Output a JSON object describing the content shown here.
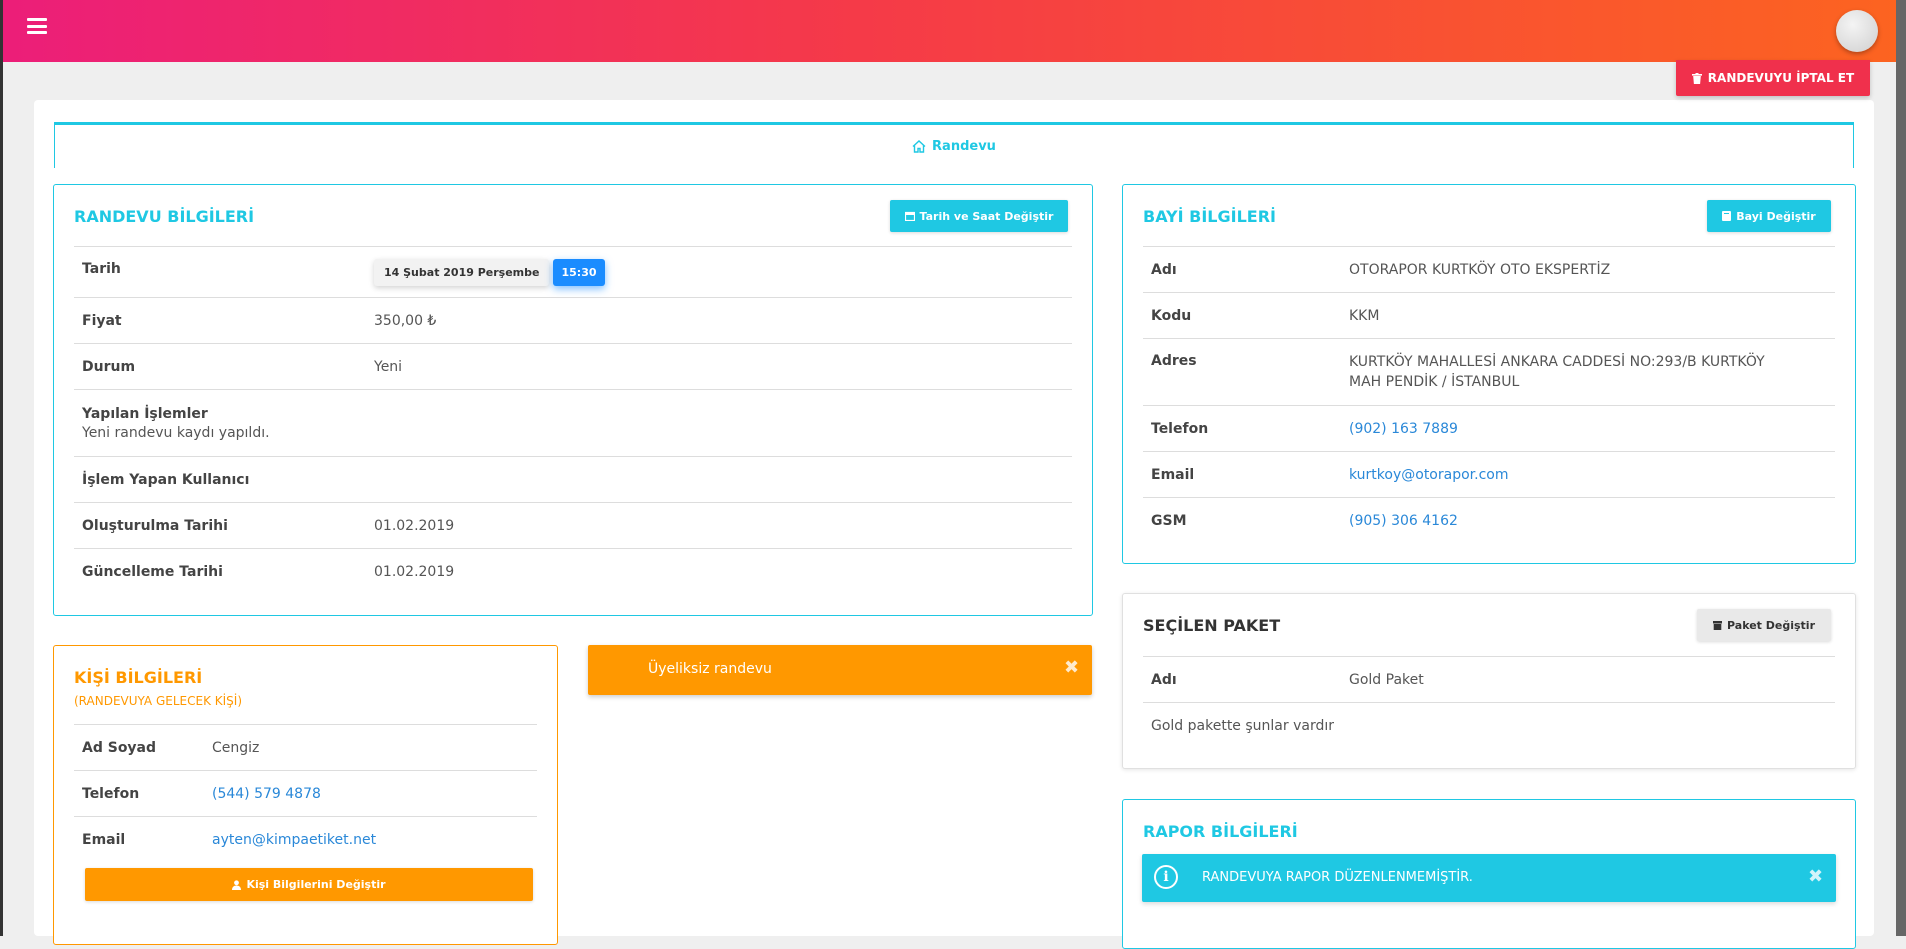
{
  "header": {
    "menu_icon": "hamburger-icon",
    "avatar_label": "user"
  },
  "cancel_button": {
    "icon": "trash-icon",
    "label": "RANDEVUYU İPTAL ET"
  },
  "tab": {
    "icon": "home-icon",
    "label": "Randevu"
  },
  "randevu": {
    "title": "RANDEVU BİLGİLERİ",
    "button": {
      "icon": "calendar-icon",
      "label": "Tarih ve Saat Değiştir"
    },
    "date_label": "Tarih",
    "date_chip": "14 Şubat 2019 Perşembe",
    "time_chip": "15:30",
    "price_label": "Fiyat",
    "price_value": "350,00 ₺",
    "status_label": "Durum",
    "status_value": "Yeni",
    "ops_label": "Yapılan İşlemler",
    "ops_value": "Yeni randevu kaydı yapıldı.",
    "user_label": "İşlem Yapan Kullanıcı",
    "created_label": "Oluşturulma Tarihi",
    "created_value": "01.02.2019",
    "updated_label": "Güncelleme Tarihi",
    "updated_value": "01.02.2019"
  },
  "kisi": {
    "title": "KİŞİ BİLGİLERİ",
    "subtitle": "(RANDEVUYA GELECEK KİŞİ)",
    "name_label": "Ad Soyad",
    "name_value": "Cengiz",
    "phone_label": "Telefon",
    "phone_value": "(544) 579 4878",
    "email_label": "Email",
    "email_value": "ayten@kimpaetiket.net",
    "button": {
      "icon": "user-icon",
      "label": "Kişi Bilgilerini Değiştir"
    }
  },
  "alert_uyeliksiz": {
    "text": "Üyeliksiz randevu",
    "close": "✖"
  },
  "bayi": {
    "title": "BAYİ BİLGİLERİ",
    "button": {
      "icon": "book-icon",
      "label": "Bayi Değiştir"
    },
    "name_label": "Adı",
    "name_value": "OTORAPOR KURTKÖY OTO EKSPERTİZ",
    "code_label": "Kodu",
    "code_value": "KKM",
    "address_label": "Adres",
    "address_value": "KURTKÖY MAHALLESİ ANKARA CADDESİ NO:293/B KURTKÖY MAH PENDİK / İSTANBUL",
    "phone_label": "Telefon",
    "phone_value": "(902) 163 7889",
    "email_label": "Email",
    "email_value": "kurtkoy@otorapor.com",
    "gsm_label": "GSM",
    "gsm_value": "(905) 306 4162"
  },
  "paket": {
    "title": "SEÇİLEN PAKET",
    "button": {
      "icon": "archive-icon",
      "label": "Paket Değiştir"
    },
    "name_label": "Adı",
    "name_value": "Gold Paket",
    "desc": "Gold pakette şunlar vardır"
  },
  "rapor": {
    "title": "RAPOR BİLGİLERİ",
    "alert_text": "RANDEVUYA RAPOR DÜZENLENMEMİŞTİR.",
    "alert_icon": "info-icon",
    "close": "✖"
  },
  "colors": {
    "accent": "#1fc8e3",
    "orange": "#ff9800",
    "danger": "#f0304c",
    "link": "#2a88d8"
  }
}
